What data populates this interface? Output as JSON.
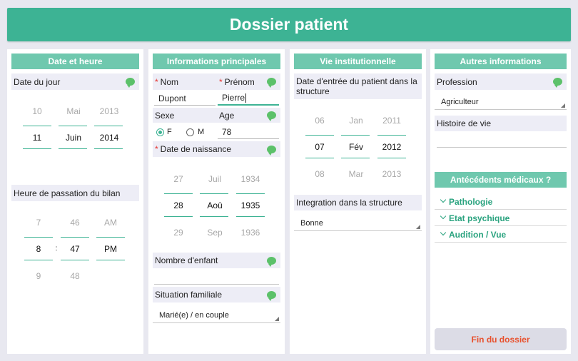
{
  "header": {
    "title": "Dossier patient"
  },
  "col1": {
    "title": "Date et heure",
    "date_label": "Date du jour",
    "date_picker": {
      "prev": [
        "10",
        "Mai",
        "2013"
      ],
      "sel": [
        "11",
        "Juin",
        "2014"
      ]
    },
    "time_label": "Heure de passation du bilan",
    "time_picker": {
      "prev": [
        "7",
        "46",
        "AM"
      ],
      "sel": [
        "8",
        "47",
        "PM"
      ],
      "next": [
        "9",
        "48"
      ],
      "sep": ":"
    }
  },
  "col2": {
    "title": "Informations principales",
    "nom_label": "Nom",
    "prenom_label": "Prénom",
    "required_mark": "*",
    "nom_value": "Dupont",
    "prenom_value": "Pierre",
    "sexe_label": "Sexe",
    "age_label": "Age",
    "sexe_options": [
      "F",
      "M"
    ],
    "sexe_selected": "F",
    "age_value": "78",
    "dob_label": "Date de naissance",
    "dob_picker": {
      "prev": [
        "27",
        "Juil",
        "1934"
      ],
      "sel": [
        "28",
        "Aoû",
        "1935"
      ],
      "next": [
        "29",
        "Sep",
        "1936"
      ]
    },
    "enfant_label": "Nombre d'enfant",
    "situation_label": "Situation familiale",
    "situation_value": "Marié(e) / en couple"
  },
  "col3": {
    "title": "Vie institutionnelle",
    "entry_label": "Date d'entrée du patient dans la structure",
    "entry_picker": {
      "prev": [
        "06",
        "Jan",
        "2011"
      ],
      "sel": [
        "07",
        "Fév",
        "2012"
      ],
      "next": [
        "08",
        "Mar",
        "2013"
      ]
    },
    "integration_label": "Integration dans la structure",
    "integration_value": "Bonne"
  },
  "col4": {
    "title": "Autres informations",
    "profession_label": "Profession",
    "profession_value": "Agriculteur",
    "histoire_label": "Histoire de vie",
    "antecedents_title": "Antécédents médicaux ?",
    "antecedents_items": [
      "Pathologie",
      "Etat psychique",
      "Audition / Vue"
    ],
    "fin_button": "Fin du dossier"
  },
  "colors": {
    "accent": "#3db394",
    "accent_light": "#6fc8ae",
    "bubble": "#5cc16a",
    "danger": "#e8502c"
  },
  "icons": {
    "comment": "comment-bubble-icon",
    "dropdown": "dropdown-triangle-icon",
    "expand": "chevron-down-icon"
  }
}
